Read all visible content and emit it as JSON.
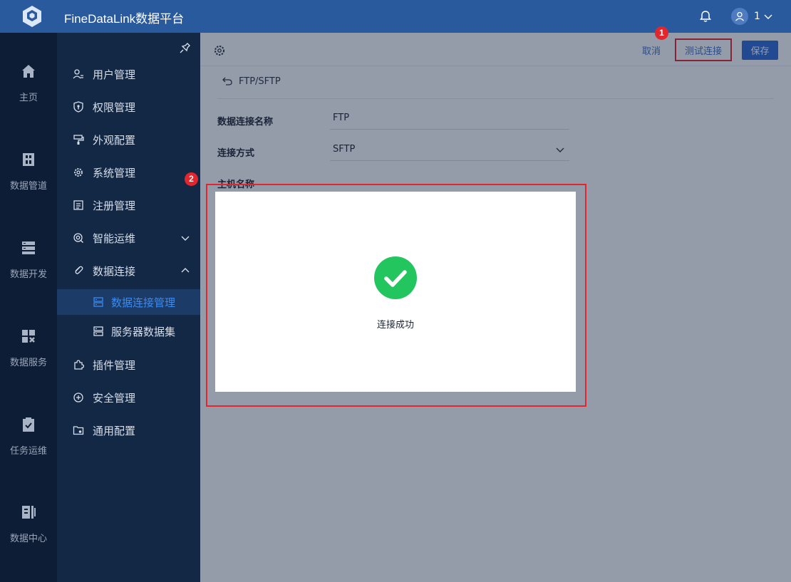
{
  "topbar": {
    "title": "FineDataLink数据平台",
    "username": "1",
    "icons": {
      "logo": "platform-logo",
      "bell": "bell-icon",
      "user": "user-icon",
      "chevron": "chevron-down-icon"
    }
  },
  "rail": {
    "items": [
      {
        "label": "主页",
        "icon": "home-icon"
      },
      {
        "label": "数据管道",
        "icon": "pipeline-icon"
      },
      {
        "label": "数据开发",
        "icon": "develop-icon"
      },
      {
        "label": "数据服务",
        "icon": "service-icon"
      },
      {
        "label": "任务运维",
        "icon": "task-icon"
      },
      {
        "label": "数据中心",
        "icon": "datacenter-icon"
      }
    ]
  },
  "sidebar": {
    "items": [
      {
        "label": "用户管理",
        "icon": "user-manage-icon"
      },
      {
        "label": "权限管理",
        "icon": "permission-icon"
      },
      {
        "label": "外观配置",
        "icon": "appearance-icon"
      },
      {
        "label": "系统管理",
        "icon": "gear-icon"
      },
      {
        "label": "注册管理",
        "icon": "register-icon"
      },
      {
        "label": "智能运维",
        "icon": "ops-icon",
        "caret": "down"
      },
      {
        "label": "数据连接",
        "icon": "link-icon",
        "caret": "up"
      },
      {
        "label": "插件管理",
        "icon": "plugin-icon"
      },
      {
        "label": "安全管理",
        "icon": "shield-icon"
      },
      {
        "label": "通用配置",
        "icon": "folder-gear-icon"
      }
    ],
    "subitems": [
      {
        "label": "数据连接管理",
        "active": true,
        "icon": "server-icon"
      },
      {
        "label": "服务器数据集",
        "active": false,
        "icon": "server-icon"
      }
    ]
  },
  "main": {
    "cancel_label": "取消",
    "test_label": "测试连接",
    "save_label": "保存",
    "breadcrumb": "FTP/SFTP",
    "fields": [
      {
        "label": "数据连接名称",
        "value": "FTP"
      },
      {
        "label": "连接方式",
        "value": "SFTP"
      },
      {
        "label": "主机名称",
        "value": ""
      }
    ]
  },
  "dialog": {
    "message": "连接成功",
    "icon": "success-check-icon"
  },
  "annotations": {
    "badge1": "1",
    "badge2": "2"
  },
  "colors": {
    "topbar": "#2a5a9e",
    "rail": "#0d1d36",
    "sidebar": "#132845",
    "accent": "#2f6bd6",
    "annotation": "#e3262e",
    "success": "#22c55e"
  }
}
